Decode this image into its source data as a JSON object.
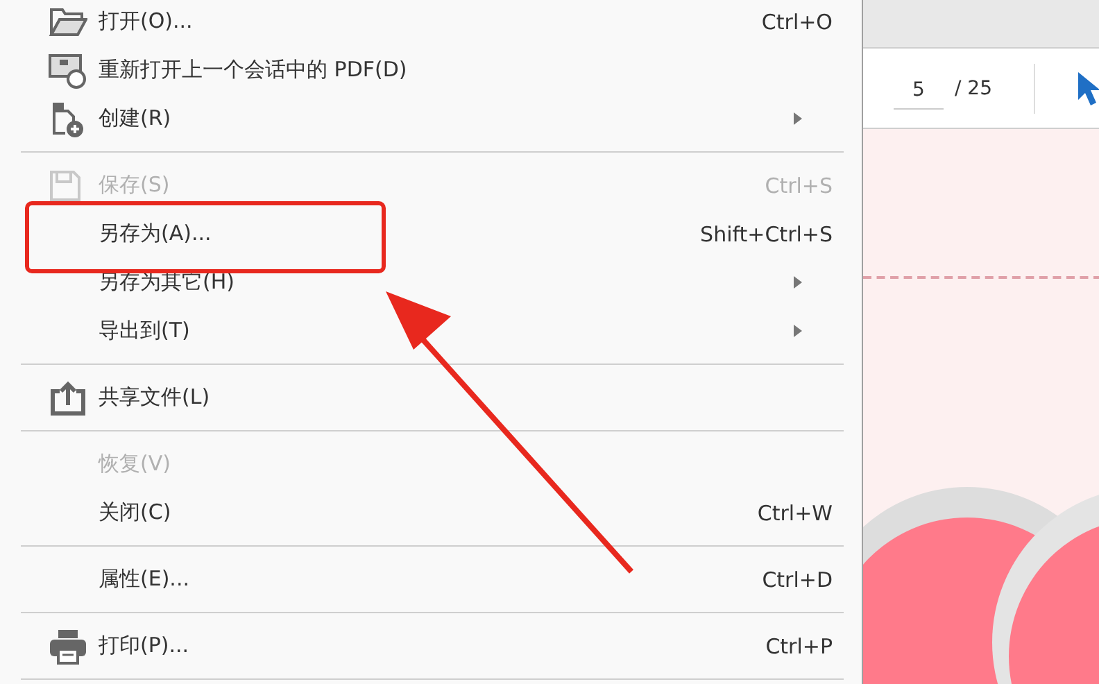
{
  "menu": {
    "items": [
      {
        "kind": "item",
        "label": "打开(O)...",
        "shortcut": "Ctrl+O",
        "disabled": false,
        "submenu": false
      },
      {
        "kind": "item",
        "label": "重新打开上一个会话中的 PDF(D)",
        "disabled": false,
        "submenu": false
      },
      {
        "kind": "item",
        "label": "创建(R)",
        "disabled": false,
        "submenu": true
      },
      {
        "kind": "separator"
      },
      {
        "kind": "item",
        "label": "保存(S)",
        "shortcut": "Ctrl+S",
        "disabled": true,
        "submenu": false
      },
      {
        "kind": "item",
        "label": "另存为(A)...",
        "shortcut": "Shift+Ctrl+S",
        "disabled": false,
        "submenu": false
      },
      {
        "kind": "item",
        "label": "另存为其它(H)",
        "disabled": false,
        "submenu": true
      },
      {
        "kind": "item",
        "label": "导出到(T)",
        "disabled": false,
        "submenu": true
      },
      {
        "kind": "separator"
      },
      {
        "kind": "item",
        "label": "共享文件(L)",
        "disabled": false,
        "submenu": false
      },
      {
        "kind": "separator"
      },
      {
        "kind": "item",
        "label": "恢复(V)",
        "disabled": true,
        "submenu": false
      },
      {
        "kind": "item",
        "label": "关闭(C)",
        "shortcut": "Ctrl+W",
        "disabled": false,
        "submenu": false
      },
      {
        "kind": "separator"
      },
      {
        "kind": "item",
        "label": "属性(E)...",
        "shortcut": "Ctrl+D",
        "disabled": false,
        "submenu": false
      },
      {
        "kind": "separator"
      },
      {
        "kind": "item",
        "label": "打印(P)...",
        "shortcut": "Ctrl+P",
        "disabled": false,
        "submenu": false
      },
      {
        "kind": "separator"
      }
    ]
  },
  "toolbar": {
    "page": "5",
    "total": "/ 25"
  }
}
